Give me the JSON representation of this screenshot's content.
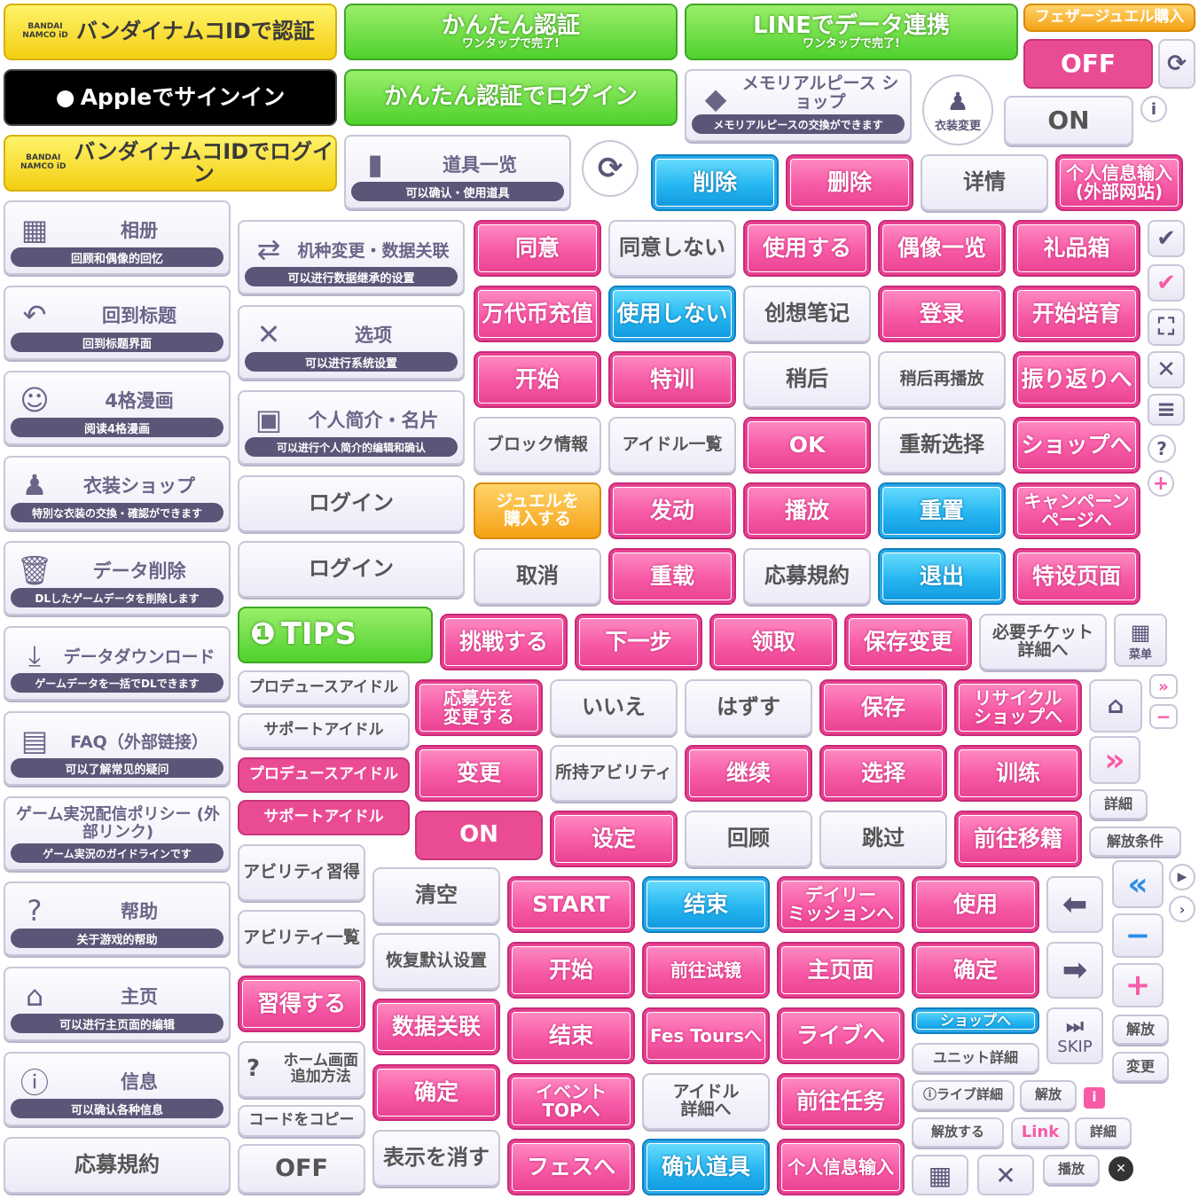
{
  "colors": {
    "pink": "#f75aa6",
    "blue": "#25b6f1",
    "white": "#f4f3fb",
    "green": "#4fd22e",
    "yellow": "#f7d92a",
    "dark": "#5a5678"
  },
  "top": {
    "bandai_auth": "バンダイナムコIDで認証",
    "bandai_logo": "BANDAI NAMCO iD",
    "line_easy": "かんたん認証",
    "line_easy_sub": "ワンタップで完了!",
    "line_link": "LINEでデータ連携",
    "line_link_sub": "ワンタップで完了!",
    "feather": "フェザージュエル購入",
    "apple": "Appleでサインイン",
    "line_login": "かんたん認証でログイン",
    "memorial": "メモリアルピース\nショップ",
    "memorial_sub": "メモリアルピースの交換ができます",
    "costume_change": "衣装変更",
    "off": "OFF",
    "on": "ON",
    "bandai_login": "バンダイナムコIDでログイン",
    "tools": "道具一览",
    "tools_sub": "可以确认・使用道具",
    "del1": "削除",
    "del2": "删除",
    "detail": "详情",
    "personal": "个人信息输入\n(外部网站)"
  },
  "menu": [
    {
      "title": "相册",
      "sub": "回顾和偶像的回忆"
    },
    {
      "title": "回到标题",
      "sub": "回到标题界面"
    },
    {
      "title": "4格漫画",
      "sub": "阅读4格漫画"
    },
    {
      "title": "衣装ショップ",
      "sub": "特別な衣装の交換・確認ができます"
    },
    {
      "title": "データ削除",
      "sub": "DLしたゲームデータを削除します"
    },
    {
      "title": "データダウンロード",
      "sub": "ゲームデータを一括でDLできます"
    },
    {
      "title": "FAQ（外部链接）",
      "sub": "可以了解常见的疑问"
    },
    {
      "title": "ゲーム実況配信ポリシー\n(外部リンク)",
      "sub": "ゲーム実況のガイドラインです"
    },
    {
      "title": "帮助",
      "sub": "关于游戏的帮助"
    },
    {
      "title": "主页",
      "sub": "可以进行主页面的编辑"
    },
    {
      "title": "信息",
      "sub": "可以确认各种信息"
    },
    {
      "title": "応募規約",
      "sub": ""
    }
  ],
  "menu2": [
    {
      "title": "机种変更・数据关联",
      "sub": "可以进行数据继承的设置"
    },
    {
      "title": "选项",
      "sub": "可以进行系统设置"
    },
    {
      "title": "个人简介・名片",
      "sub": "可以进行个人简介的编辑和确认"
    }
  ],
  "grid": [
    [
      "同意",
      "同意しない",
      "使用する",
      "偶像一览",
      "礼品箱"
    ],
    [
      "万代币充值",
      "使用しない",
      "创想笔记",
      "登录",
      "开始培育"
    ],
    [
      "开始",
      "特训",
      "稍后",
      "稍后再播放",
      "振り返りへ"
    ],
    [
      "ブロック情報",
      "アイドル一覧",
      "OK",
      "重新选择",
      "ショップへ"
    ],
    [
      "ジュエルを\n購入する",
      "发动",
      "播放",
      "重置",
      "キャンペーン\nページへ"
    ],
    [
      "取消",
      "重载",
      "応募規約",
      "退出",
      "特设页面"
    ]
  ],
  "col2": {
    "login1": "ログイン",
    "login2": "ログイン",
    "tips": "TIPS",
    "tab1": "プロデュースアイドル",
    "tab2": "サポートアイドル",
    "tab3": "プロデュースアイドル",
    "tab4": "サポートアイドル",
    "on": "ON",
    "ability_learn": "アビリティ習得",
    "ability_list": "アビリティ一覧",
    "learn": "習得する",
    "home_add": "ホーム画面\n追加方法",
    "copy": "コードをコピー",
    "off": "OFF"
  },
  "row7": [
    "挑戦する",
    "下一步",
    "领取",
    "保存变更",
    "必要チケット\n詳細へ"
  ],
  "menu_label": "菜单",
  "row8": [
    "応募先を\n変更する",
    "いいえ",
    "はずす",
    "保存",
    "リサイクル\nショップへ"
  ],
  "row9": [
    "变更",
    "所持アビリティ",
    "继续",
    "选择",
    "训练"
  ],
  "row10": [
    "设定",
    "回顾",
    "跳过",
    "前往移籍"
  ],
  "small": {
    "shosai": "詳細",
    "kaiho": "解放条件",
    "skip": "SKIP",
    "kaiho2": "解放",
    "henko": "変更"
  },
  "col3": [
    "清空",
    "恢复默认设置",
    "数据关联",
    "确定",
    "表示を消す"
  ],
  "bottom": [
    [
      "START",
      "结束",
      "デイリー\nミッションへ",
      "使用"
    ],
    [
      "开始",
      "前往试镜",
      "主页面",
      "确定"
    ],
    [
      "结束",
      "Fes Toursへ",
      "ライブへ"
    ],
    [
      "イベント\nTOPへ",
      "アイドル\n詳細へ",
      "前往任务"
    ],
    [
      "フェスへ",
      "确认道具",
      "个人信息输入"
    ]
  ],
  "tiny": {
    "shop": "ショップへ",
    "unit": "ユニット詳細",
    "live_detail": "ライブ詳細",
    "kaiho": "解放",
    "kaiho_suru": "解放する",
    "link": "Link",
    "shosai": "詳細",
    "play": "播放"
  },
  "icons": [
    "check-icon",
    "close-icon",
    "menu-icon",
    "help-icon",
    "plus-icon",
    "refresh-icon",
    "info-icon",
    "home-icon",
    "fast-forward-icon",
    "rewind-icon",
    "minus-icon",
    "arrow-left-icon",
    "arrow-right-icon",
    "grid-icon"
  ]
}
